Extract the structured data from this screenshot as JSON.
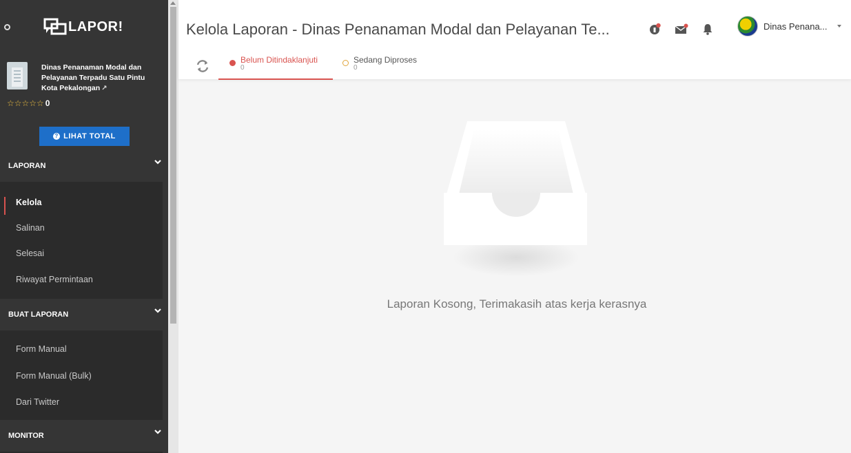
{
  "app": {
    "logo_text": "LAPOR!"
  },
  "profile": {
    "name": "Dinas Penanaman Modal dan Pelayanan Terpadu Satu Pintu Kota Pekalongan",
    "stars": "☆☆☆☆☆",
    "rating": "0"
  },
  "sidebar": {
    "total_button": "LIHAT TOTAL",
    "sections": [
      {
        "title": "LAPORAN",
        "items": [
          "Kelola",
          "Salinan",
          "Selesai",
          "Riwayat Permintaan"
        ]
      },
      {
        "title": "BUAT LAPORAN",
        "items": [
          "Form Manual",
          "Form Manual (Bulk)",
          "Dari Twitter"
        ]
      },
      {
        "title": "MONITOR",
        "items": []
      }
    ]
  },
  "header": {
    "title": "Kelola Laporan - Dinas Penanaman Modal dan Pelayanan Te...",
    "user_name": "Dinas Penana..."
  },
  "tabs": [
    {
      "label": "Belum Ditindaklanjuti",
      "count": "0"
    },
    {
      "label": "Sedang Diproses",
      "count": "0"
    }
  ],
  "empty_state": {
    "message": "Laporan Kosong, Terimakasih atas kerja kerasnya"
  },
  "colors": {
    "sidebar_bg": "#353535",
    "accent_red": "#d9534f",
    "button_blue": "#1e6fc9",
    "tab_orange": "#e0a53b"
  }
}
